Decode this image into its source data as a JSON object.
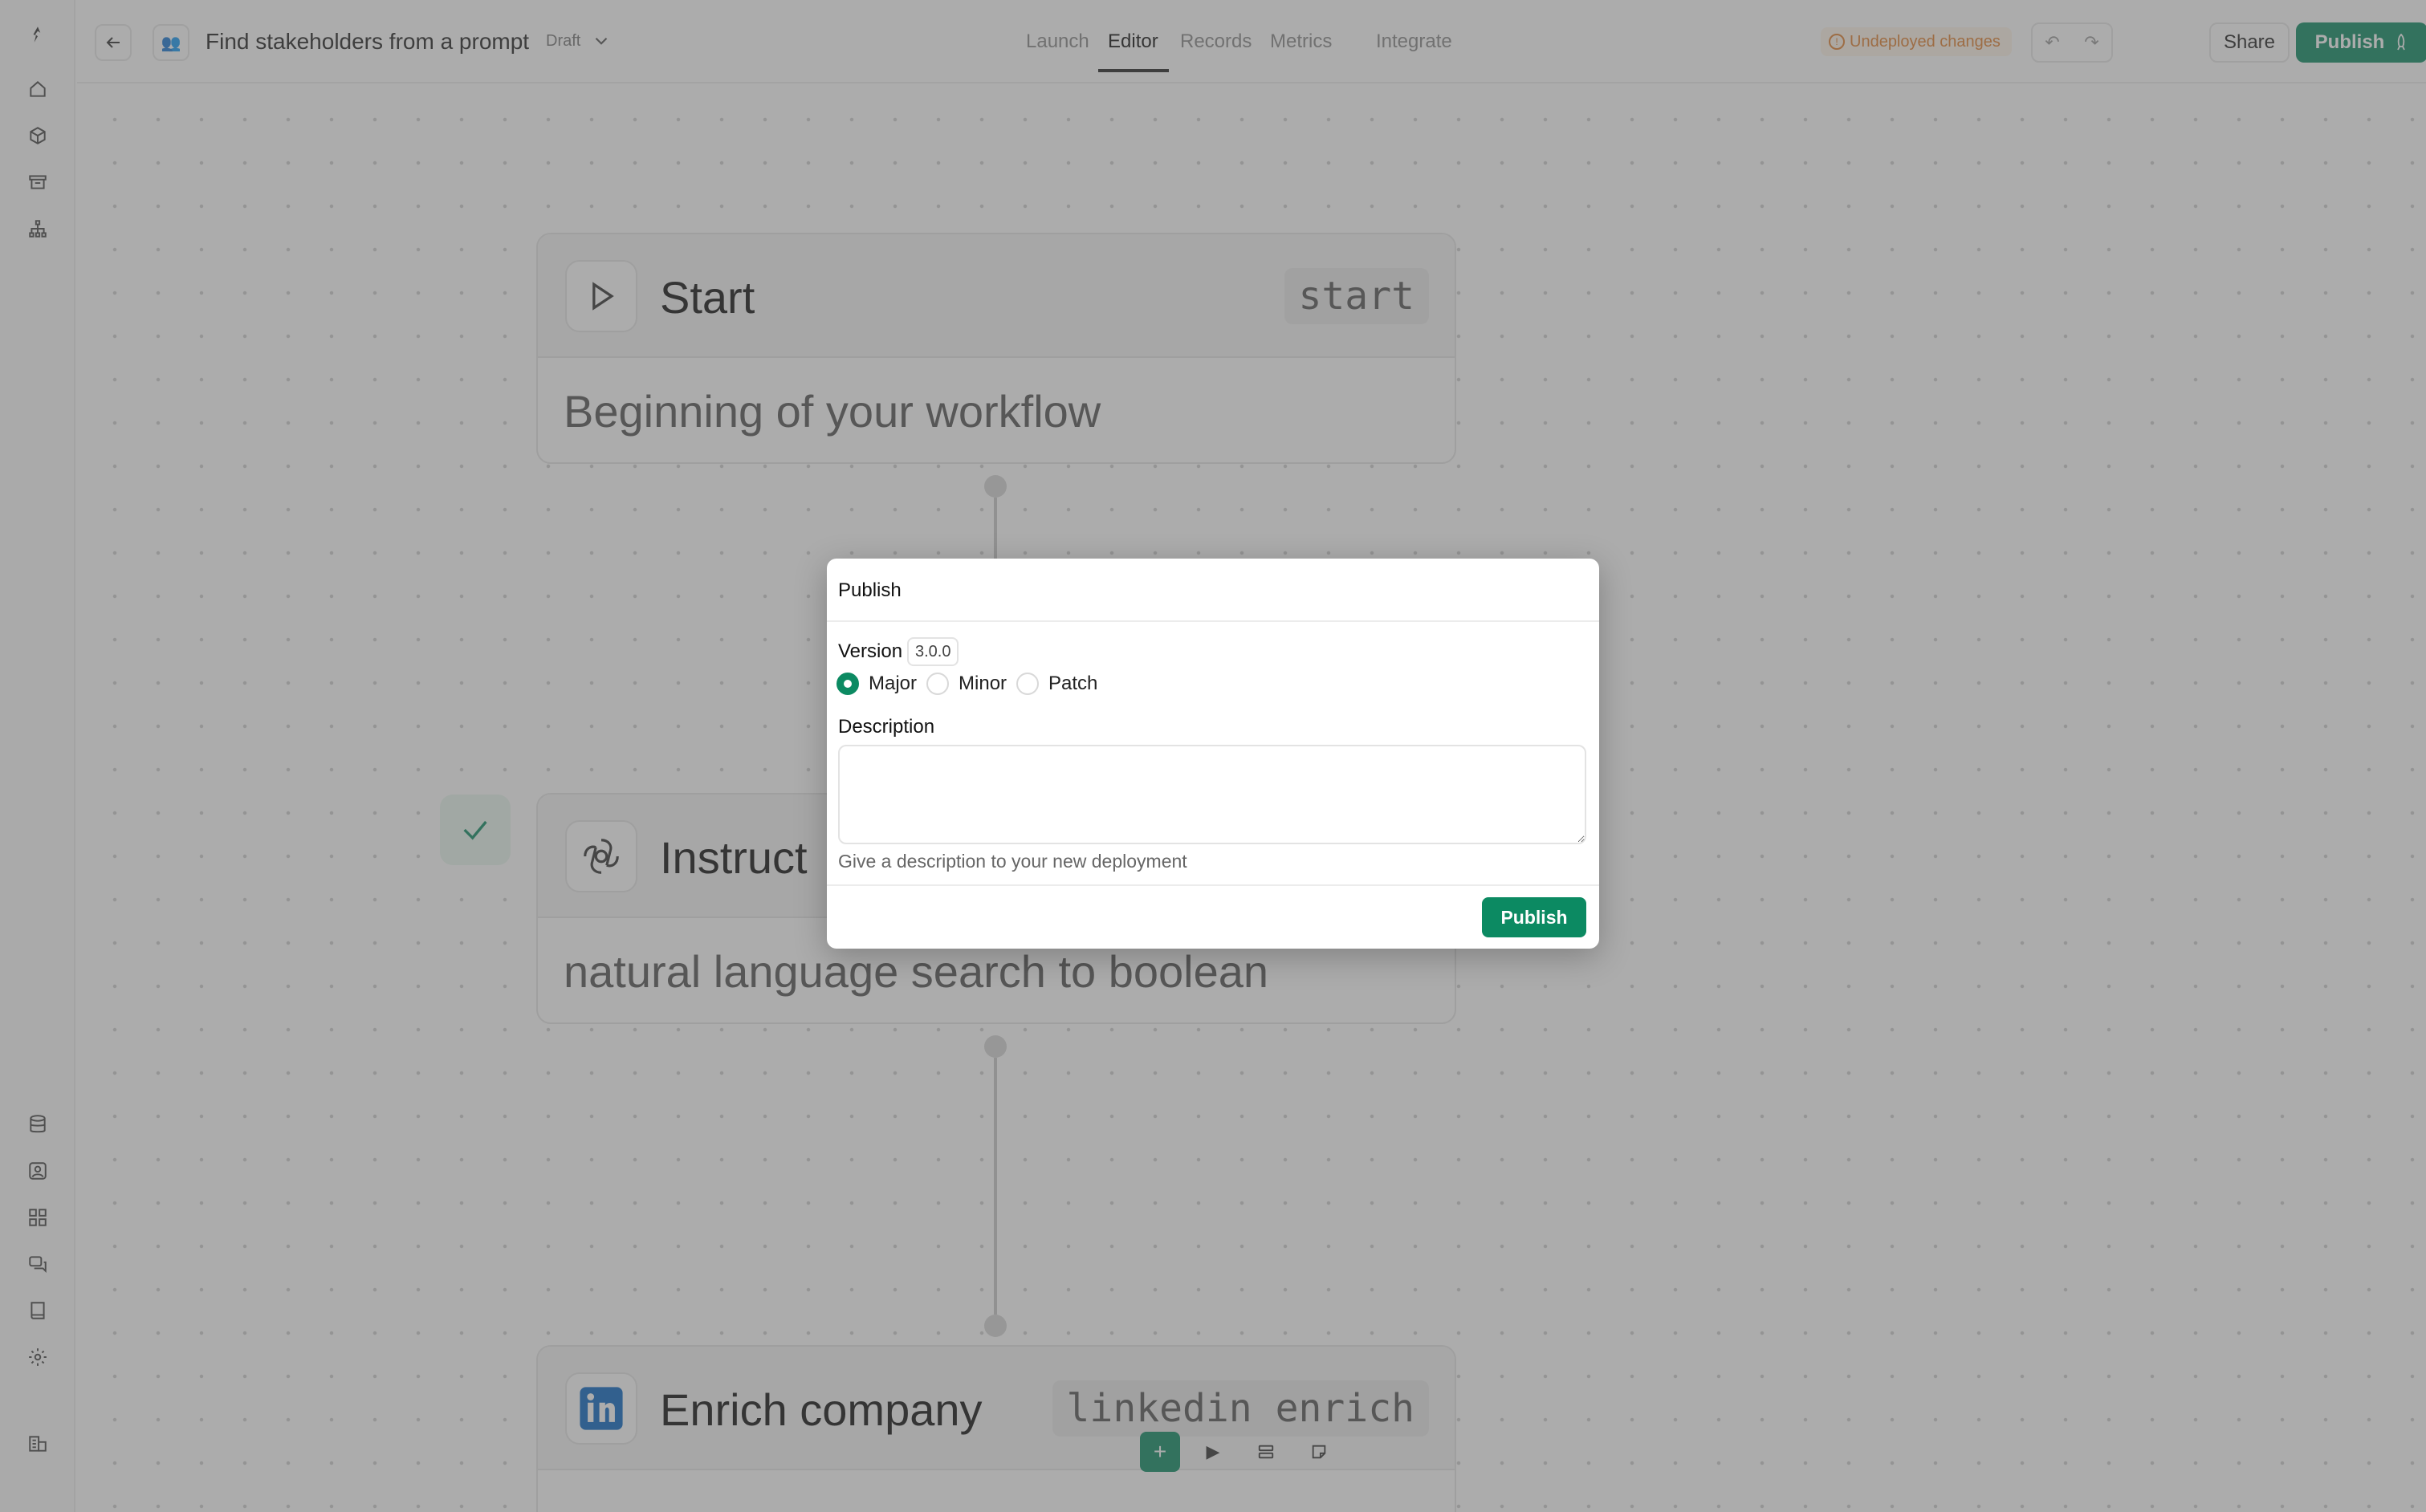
{
  "workflow": {
    "title": "Find stakeholders from a prompt",
    "status": "Draft"
  },
  "tabs": [
    "Launch",
    "Editor",
    "Records",
    "Metrics",
    "Integrate"
  ],
  "active_tab": "Editor",
  "header": {
    "undeployed_label": "Undeployed changes",
    "share_label": "Share",
    "publish_label": "Publish",
    "more_glyph": "⋯"
  },
  "nodes": [
    {
      "title": "Start",
      "tag": "start",
      "description": "Beginning of your workflow"
    },
    {
      "title": "Instruct",
      "description": "natural language search to boolean"
    },
    {
      "title": "Enrich company",
      "tag": "linkedin enrich"
    }
  ],
  "dialog": {
    "title": "Publish",
    "version_label": "Version",
    "version_value": "3.0.0",
    "options": [
      "Major",
      "Minor",
      "Patch"
    ],
    "selected_option": "Major",
    "description_label": "Description",
    "description_value": "",
    "hint": "Give a description to your new deployment",
    "publish_button": "Publish"
  },
  "colors": {
    "accent": "#0c8a62",
    "warning": "#e08030",
    "overlay": "rgba(90,90,90,0.5)"
  }
}
